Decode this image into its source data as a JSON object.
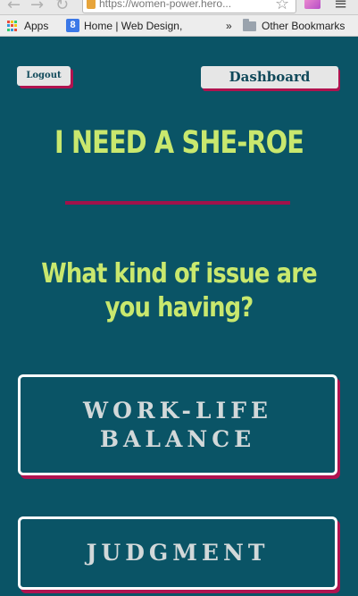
{
  "browser": {
    "url": "https://women-power.hero...",
    "bookmarks": {
      "apps_label": "Apps",
      "home_label": "Home | Web Design,",
      "g_badge": "8",
      "overflow": "»",
      "other_label": "Other Bookmarks"
    },
    "icons": [
      "back-icon",
      "forward-icon",
      "reload-icon",
      "lock-icon",
      "star-icon",
      "extension-icon",
      "menu-icon",
      "apps-icon",
      "folder-icon"
    ]
  },
  "header": {
    "logout_label": "Logout",
    "dashboard_label": "Dashboard"
  },
  "main": {
    "title": "I NEED A SHE-ROE",
    "question": "What kind of issue are you having?",
    "options": [
      {
        "label": "WORK-LIFE BALANCE"
      },
      {
        "label": "JUDGMENT"
      }
    ]
  },
  "colors": {
    "background": "#0a5466",
    "accent_green": "#c9e86e",
    "accent_magenta": "#b0134f",
    "button_light": "#e6e6e6"
  }
}
